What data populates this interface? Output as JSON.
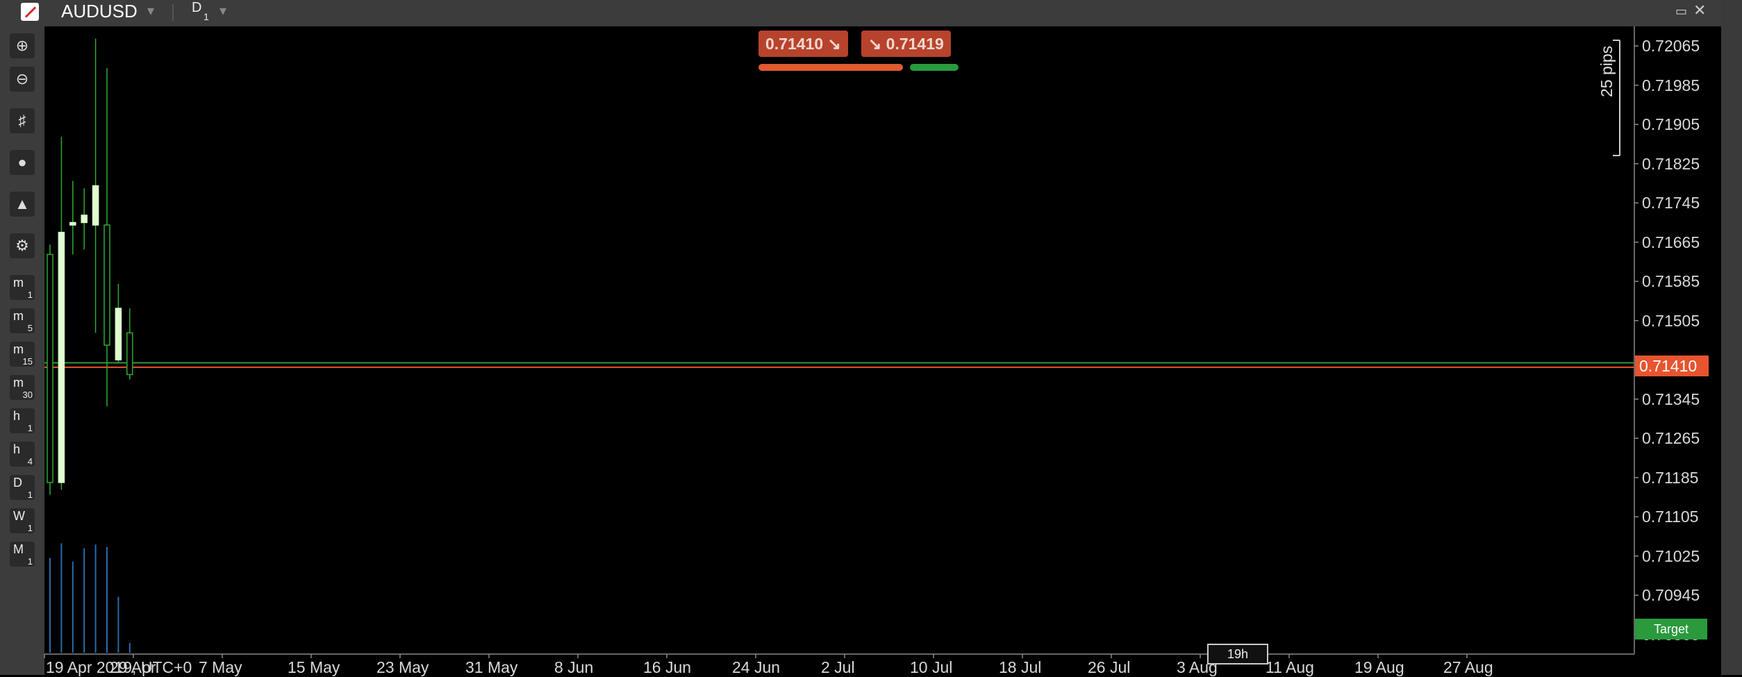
{
  "header": {
    "symbol": "AUDUSD",
    "timeframe_letter": "D",
    "timeframe_num": "1"
  },
  "price_axis": [
    "0.72065",
    "0.71985",
    "0.71905",
    "0.71825",
    "0.71745",
    "0.71665",
    "0.71585",
    "0.71505",
    "0.71345",
    "0.71265",
    "0.71185",
    "0.71105",
    "0.71025",
    "0.70945",
    "0.70865"
  ],
  "current_price": "0.71410",
  "target_label": "Target",
  "quote": {
    "sell": "0.71410",
    "buy": "0.71419",
    "sell_icon": "arrow-down-right",
    "buy_icon": "arrow-down-right"
  },
  "spread_label": "25 pips",
  "time_marker": "19h",
  "x_axis": [
    "19 Apr 2019, UTC+0",
    "29 Apr",
    "7 May",
    "15 May",
    "23 May",
    "31 May",
    "8 Jun",
    "16 Jun",
    "24 Jun",
    "2 Jul",
    "10 Jul",
    "18 Jul",
    "26 Jul",
    "3 Aug",
    "11 Aug",
    "19 Aug",
    "27 Aug"
  ],
  "toolbar_timeframes": [
    {
      "letter": "m",
      "num": "1"
    },
    {
      "letter": "m",
      "num": "5"
    },
    {
      "letter": "m",
      "num": "15"
    },
    {
      "letter": "m",
      "num": "30"
    },
    {
      "letter": "h",
      "num": "1"
    },
    {
      "letter": "h",
      "num": "4"
    },
    {
      "letter": "D",
      "num": "1"
    },
    {
      "letter": "W",
      "num": "1"
    },
    {
      "letter": "M",
      "num": "1"
    }
  ],
  "colors": {
    "up": "#dfffcf",
    "down": "#2faa2f",
    "ask_line": "#e8542f",
    "bid_line": "#2a9a3c",
    "volume": "#2a6bb0"
  },
  "chart_data": {
    "type": "candlestick",
    "ylim": [
      0.70825,
      0.72105
    ],
    "candles": [
      {
        "o": 0.7164,
        "h": 0.7166,
        "l": 0.7115,
        "c": 0.71175
      },
      {
        "o": 0.71175,
        "h": 0.7188,
        "l": 0.7116,
        "c": 0.71685
      },
      {
        "o": 0.717,
        "h": 0.7179,
        "l": 0.7164,
        "c": 0.71705
      },
      {
        "o": 0.71705,
        "h": 0.71775,
        "l": 0.7165,
        "c": 0.7172
      },
      {
        "o": 0.717,
        "h": 0.7208,
        "l": 0.7148,
        "c": 0.7178
      },
      {
        "o": 0.717,
        "h": 0.7202,
        "l": 0.7133,
        "c": 0.71455
      },
      {
        "o": 0.71425,
        "h": 0.7158,
        "l": 0.7142,
        "c": 0.7153
      },
      {
        "o": 0.7148,
        "h": 0.7153,
        "l": 0.71385,
        "c": 0.71395
      }
    ],
    "volumes": [
      0.78,
      0.9,
      0.75,
      0.86,
      0.89,
      0.87,
      0.46,
      0.08
    ],
    "ask": 0.71419,
    "bid": 0.7141
  }
}
